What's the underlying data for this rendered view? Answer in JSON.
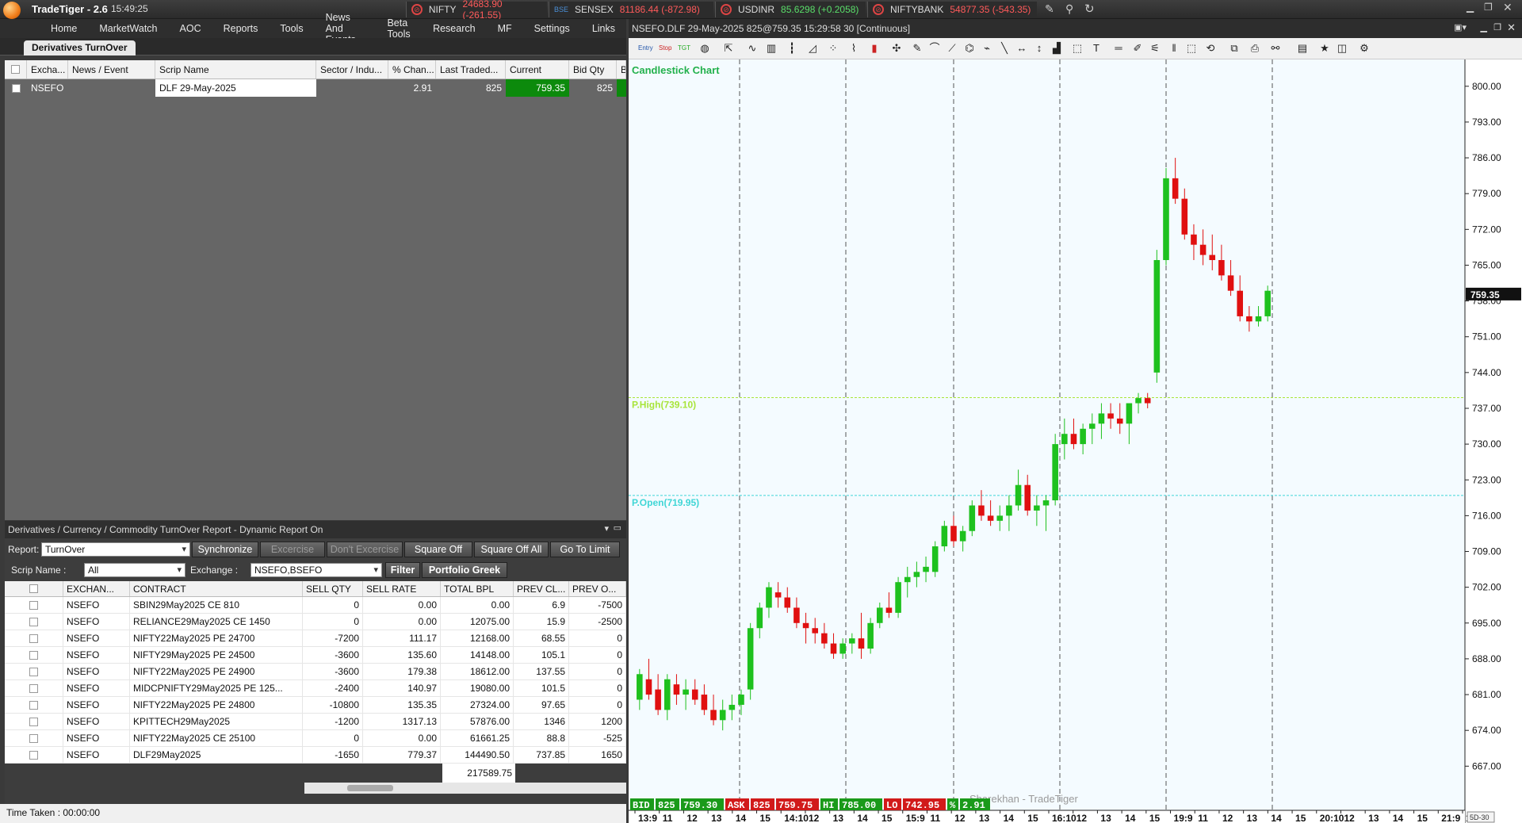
{
  "app": {
    "title": "TradeTiger - 2.6",
    "time": "15:49:25"
  },
  "tickers": [
    {
      "name": "NIFTY",
      "value": "24683.90 (-261.55)",
      "dir": "dn"
    },
    {
      "name": "SENSEX",
      "value": "81186.44 (-872.98)",
      "dir": "dn"
    },
    {
      "name": "USDINR",
      "value": "85.6298 (+0.2058)",
      "dir": "up"
    },
    {
      "name": "NIFTYBANK",
      "value": "54877.35 (-543.35)",
      "dir": "dn"
    }
  ],
  "menu": [
    "Home",
    "MarketWatch",
    "AOC",
    "Reports",
    "Tools",
    "News And Events",
    "Beta Tools",
    "Research",
    "MF",
    "Settings",
    "Links"
  ],
  "tab": "Derivatives TurnOver",
  "watch": {
    "headers": [
      "Excha...",
      "News / Event",
      "Scrip Name",
      "Sector / Indu...",
      "% Chan...",
      "Last Traded...",
      "Current",
      "Bid Qty",
      "Bi"
    ],
    "row": {
      "exchange": "NSEFO",
      "scrip": "DLF 29-May-2025",
      "pct": "2.91",
      "ltq": "825",
      "current": "759.35",
      "bidqty": "825"
    }
  },
  "report": {
    "title": "Derivatives  / Currency / Commodity TurnOver Report - Dynamic Report On",
    "report_label": "Report:",
    "report_value": "TurnOver",
    "scrip_label": "Scrip Name :",
    "scrip_value": "All",
    "exchange_label": "Exchange :",
    "exchange_value": "NSEFO,BSEFO",
    "buttons": {
      "sync": "Synchronize",
      "exercise": "Excercise",
      "dont": "Don't Excercise",
      "sqoff": "Square Off",
      "sqoffall": "Square Off All",
      "golimit": "Go To Limit",
      "filter": "Filter",
      "greek": "Portfolio Greek"
    },
    "headers": [
      "EXCHAN...",
      "CONTRACT",
      "SELL QTY",
      "SELL RATE",
      "TOTAL BPL",
      "PREV CL...",
      "PREV O..."
    ],
    "rows": [
      [
        "NSEFO",
        "SBIN29May2025 CE 810",
        "0",
        "0.00",
        "0.00",
        "6.9",
        "-7500"
      ],
      [
        "NSEFO",
        "RELIANCE29May2025 CE 1450",
        "0",
        "0.00",
        "12075.00",
        "15.9",
        "-2500"
      ],
      [
        "NSEFO",
        "NIFTY22May2025 PE 24700",
        "-7200",
        "111.17",
        "12168.00",
        "68.55",
        "0"
      ],
      [
        "NSEFO",
        "NIFTY29May2025 PE 24500",
        "-3600",
        "135.60",
        "14148.00",
        "105.1",
        "0"
      ],
      [
        "NSEFO",
        "NIFTY22May2025 PE 24900",
        "-3600",
        "179.38",
        "18612.00",
        "137.55",
        "0"
      ],
      [
        "NSEFO",
        "MIDCPNIFTY29May2025 PE 125...",
        "-2400",
        "140.97",
        "19080.00",
        "101.5",
        "0"
      ],
      [
        "NSEFO",
        "NIFTY22May2025 PE 24800",
        "-10800",
        "135.35",
        "27324.00",
        "97.65",
        "0"
      ],
      [
        "NSEFO",
        "KPITTECH29May2025",
        "-1200",
        "1317.13",
        "57876.00",
        "1346",
        "1200"
      ],
      [
        "NSEFO",
        "NIFTY22May2025 CE 25100",
        "0",
        "0.00",
        "61661.25",
        "88.8",
        "-525"
      ],
      [
        "NSEFO",
        "DLF29May2025",
        "-1650",
        "779.37",
        "144490.50",
        "737.85",
        "1650"
      ]
    ],
    "total": "217589.75"
  },
  "status": "Time Taken : 00:00:00",
  "chart_window_title": "NSEFO.DLF 29-May-2025 825@759.35 15:29:58 30 [Continuous]",
  "chart_data": {
    "type": "candlestick",
    "title": "Candlestick Chart",
    "watermark": "Sharekhan - TradeTiger",
    "ylim": [
      661,
      804
    ],
    "yticks": [
      "800.00",
      "793.00",
      "786.00",
      "779.00",
      "772.00",
      "765.00",
      "758.00",
      "751.00",
      "744.00",
      "737.00",
      "730.00",
      "723.00",
      "716.00",
      "709.00",
      "702.00",
      "695.00",
      "688.00",
      "681.00",
      "674.00",
      "667.00"
    ],
    "ytick_values": [
      800,
      793,
      786,
      779,
      772,
      765,
      758,
      751,
      744,
      737,
      730,
      723,
      716,
      709,
      702,
      695,
      688,
      681,
      674,
      667
    ],
    "last_price": "759.35",
    "last_value": 759.35,
    "ref_lines": [
      {
        "label": "P.High(739.10)",
        "value": 739.1,
        "color": "#a8e53a"
      },
      {
        "label": "P.Open(719.95)",
        "value": 719.95,
        "color": "#3fd6d6"
      }
    ],
    "xticks": [
      "13:9",
      "11",
      "12",
      "13",
      "14",
      "15",
      "14:10",
      "12",
      "13",
      "14",
      "15",
      "15:9",
      "11",
      "12",
      "13",
      "14",
      "15",
      "16:10",
      "12",
      "13",
      "14",
      "15",
      "19:9",
      "11",
      "12",
      "13",
      "14",
      "15",
      "20:10",
      "12",
      "13",
      "14",
      "15",
      "21:9",
      "1"
    ],
    "info_bar": [
      {
        "label": "BID",
        "v1": "825",
        "v2": "759.30",
        "color": "#1a9a1a"
      },
      {
        "label": "ASK",
        "v1": "825",
        "v2": "759.75",
        "color": "#d11a1a"
      },
      {
        "label": "HI",
        "v1": "785.00",
        "v2": "",
        "color": "#1a9a1a"
      },
      {
        "label": "LO",
        "v1": "742.95",
        "v2": "",
        "color": "#d11a1a"
      },
      {
        "label": "%",
        "v1": "2.91",
        "v2": "",
        "color": "#1a9a1a"
      }
    ],
    "corner": "5D-30",
    "candles": [
      [
        680,
        686,
        678,
        685
      ],
      [
        684,
        688,
        680,
        681
      ],
      [
        682,
        685,
        677,
        678
      ],
      [
        678,
        685,
        676,
        684
      ],
      [
        683,
        685,
        679,
        681
      ],
      [
        681,
        684,
        678,
        682
      ],
      [
        682,
        684,
        679,
        680
      ],
      [
        681,
        683,
        677,
        678
      ],
      [
        678,
        681,
        675,
        676
      ],
      [
        676,
        680,
        674,
        678
      ],
      [
        678,
        681,
        676,
        679
      ],
      [
        679,
        682,
        677,
        681
      ],
      [
        682,
        695,
        680,
        694
      ],
      [
        694,
        699,
        692,
        698
      ],
      [
        698,
        703,
        696,
        702
      ],
      [
        701,
        703,
        698,
        700
      ],
      [
        700,
        702,
        697,
        698
      ],
      [
        698,
        700,
        694,
        695
      ],
      [
        695,
        697,
        691,
        694
      ],
      [
        694,
        696,
        691,
        693
      ],
      [
        693,
        695,
        690,
        691
      ],
      [
        691,
        693,
        688,
        689
      ],
      [
        689,
        692,
        688,
        691
      ],
      [
        691,
        693,
        689,
        692
      ],
      [
        692,
        697,
        688,
        690
      ],
      [
        690,
        696,
        689,
        695
      ],
      [
        695,
        699,
        694,
        698
      ],
      [
        698,
        701,
        696,
        697
      ],
      [
        697,
        704,
        696,
        703
      ],
      [
        703,
        706,
        700,
        704
      ],
      [
        704,
        707,
        702,
        705
      ],
      [
        705,
        708,
        703,
        706
      ],
      [
        705,
        711,
        704,
        710
      ],
      [
        710,
        715,
        709,
        714
      ],
      [
        714,
        716,
        710,
        711
      ],
      [
        711,
        714,
        709,
        713
      ],
      [
        713,
        719,
        712,
        718
      ],
      [
        718,
        721,
        715,
        716
      ],
      [
        716,
        719,
        714,
        715
      ],
      [
        715,
        718,
        713,
        716
      ],
      [
        716,
        720,
        713,
        718
      ],
      [
        718,
        725,
        717,
        722
      ],
      [
        722,
        724,
        716,
        717
      ],
      [
        717,
        720,
        714,
        718
      ],
      [
        718,
        720,
        713,
        719
      ],
      [
        719,
        732,
        718,
        730
      ],
      [
        730,
        735,
        727,
        732
      ],
      [
        732,
        735,
        729,
        730
      ],
      [
        730,
        734,
        728,
        733
      ],
      [
        733,
        736,
        730,
        734
      ],
      [
        734,
        738,
        731,
        736
      ],
      [
        736,
        738,
        733,
        735
      ],
      [
        735,
        738,
        732,
        734
      ],
      [
        734,
        737,
        730,
        738
      ],
      [
        738,
        740,
        736,
        739
      ],
      [
        739,
        740,
        737,
        738
      ],
      [
        744,
        768,
        742,
        766
      ],
      [
        766,
        784,
        765,
        782
      ],
      [
        782,
        786,
        777,
        778
      ],
      [
        778,
        780,
        770,
        771
      ],
      [
        771,
        773,
        766,
        769
      ],
      [
        769,
        772,
        765,
        767
      ],
      [
        767,
        771,
        764,
        766
      ],
      [
        766,
        769,
        762,
        763
      ],
      [
        763,
        766,
        759,
        760
      ],
      [
        760,
        763,
        754,
        755
      ],
      [
        755,
        757,
        752,
        754
      ],
      [
        754,
        757,
        753,
        755
      ],
      [
        755,
        761,
        754,
        760
      ]
    ]
  }
}
